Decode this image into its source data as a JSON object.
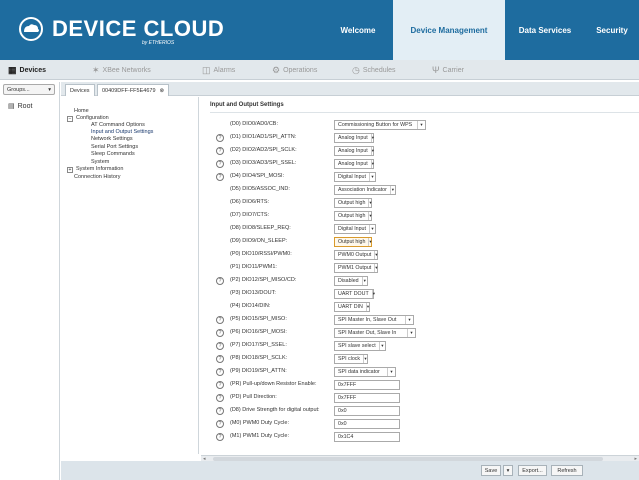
{
  "brand": {
    "name": "DEVICE CLOUD",
    "sub": "by ETHERIOS"
  },
  "topnav": {
    "welcome": "Welcome",
    "device_management": "Device Management",
    "data_services": "Data Services",
    "security": "Security"
  },
  "subnav": {
    "devices": "Devices",
    "xbee": "XBee Networks",
    "alarms": "Alarms",
    "operations": "Operations",
    "schedules": "Schedules",
    "carrier": "Carrier"
  },
  "left": {
    "groups": "Groups...",
    "root": "Root"
  },
  "device_tabs": {
    "devices": "Devices",
    "device_id": "00409DFF-FF5E4679"
  },
  "tree": {
    "home": "Home",
    "configuration": "Configuration",
    "at_command_options": "AT Command Options",
    "input_output_settings": "Input and Output Settings",
    "network_settings": "Network Settings",
    "serial_port_settings": "Serial Port Settings",
    "sleep_commands": "Sleep Commands",
    "system": "System",
    "system_information": "System Information",
    "connection_history": "Connection History"
  },
  "main": {
    "section_title": "Input and Output Settings",
    "rows": [
      {
        "label": "(D0) DIO0/AD0/CB:",
        "value": "Commissioning Button for WPS",
        "help": false,
        "kind": "select"
      },
      {
        "label": "(D1) DIO1/AD1/SPI_ATTN:",
        "value": "Analog Input",
        "help": true,
        "kind": "select"
      },
      {
        "label": "(D2) DIO2/AD2/SPI_SCLK:",
        "value": "Analog Input",
        "help": true,
        "kind": "select"
      },
      {
        "label": "(D3) DIO3/AD3/SPI_SSEL:",
        "value": "Analog Input",
        "help": true,
        "kind": "select"
      },
      {
        "label": "(D4) DIO4/SPI_MOSI:",
        "value": "Digital Input",
        "help": true,
        "kind": "select"
      },
      {
        "label": "(D5) DIO5/ASSOC_IND:",
        "value": "Association Indicator",
        "help": false,
        "kind": "select"
      },
      {
        "label": "(D6) DIO6/RTS:",
        "value": "Output high",
        "help": false,
        "kind": "select"
      },
      {
        "label": "(D7) DIO7/CTS:",
        "value": "Output high",
        "help": false,
        "kind": "select"
      },
      {
        "label": "(D8) DIO8/SLEEP_REQ:",
        "value": "Digital Input",
        "help": false,
        "kind": "select"
      },
      {
        "label": "(D9) DIO9/ON_SLEEP:",
        "value": "Output high",
        "help": false,
        "kind": "select",
        "highlight": true
      },
      {
        "label": "(P0) DIO10/RSSI/PWM0:",
        "value": "PWM0 Output",
        "help": false,
        "kind": "select"
      },
      {
        "label": "(P1) DIO11/PWM1:",
        "value": "PWM1 Output",
        "help": false,
        "kind": "select"
      },
      {
        "label": "(P2) DIO12/SPI_MISO/CD:",
        "value": "Disabled",
        "help": true,
        "kind": "select"
      },
      {
        "label": "(P3) DIO13/DOUT:",
        "value": "UART DOUT",
        "help": false,
        "kind": "select"
      },
      {
        "label": "(P4) DIO14/DIN:",
        "value": "UART DIN",
        "help": false,
        "kind": "select"
      },
      {
        "label": "(P5) DIO15/SPI_MISO:",
        "value": "SPI Master In, Slave Out",
        "help": true,
        "kind": "select"
      },
      {
        "label": "(P6) DIO16/SPI_MOSI:",
        "value": "SPI Master Out, Slave In",
        "help": true,
        "kind": "select"
      },
      {
        "label": "(P7) DIO17/SPI_SSEL:",
        "value": "SPI slave select",
        "help": true,
        "kind": "select"
      },
      {
        "label": "(P8) DIO18/SPI_SCLK:",
        "value": "SPI clock",
        "help": true,
        "kind": "select"
      },
      {
        "label": "(P9) DIO19/SPI_ATTN:",
        "value": "SPI data indicator",
        "help": true,
        "kind": "select"
      },
      {
        "label": "(PR) Pull-up/down Resistor Enable:",
        "value": "0x7FFF",
        "help": true,
        "kind": "input"
      },
      {
        "label": "(PD) Pull Direction:",
        "value": "0x7FFF",
        "help": true,
        "kind": "input"
      },
      {
        "label": "(D8) Drive Strength for digital output:",
        "value": "0x0",
        "help": true,
        "kind": "input"
      },
      {
        "label": "(M0) PWM0 Duty Cycle:",
        "value": "0x0",
        "help": true,
        "kind": "input"
      },
      {
        "label": "(M1) PWM1 Duty Cycle:",
        "value": "0x1C4",
        "help": true,
        "kind": "input"
      }
    ]
  },
  "footer": {
    "save": "Save",
    "export": "Export...",
    "refresh": "Refresh"
  }
}
